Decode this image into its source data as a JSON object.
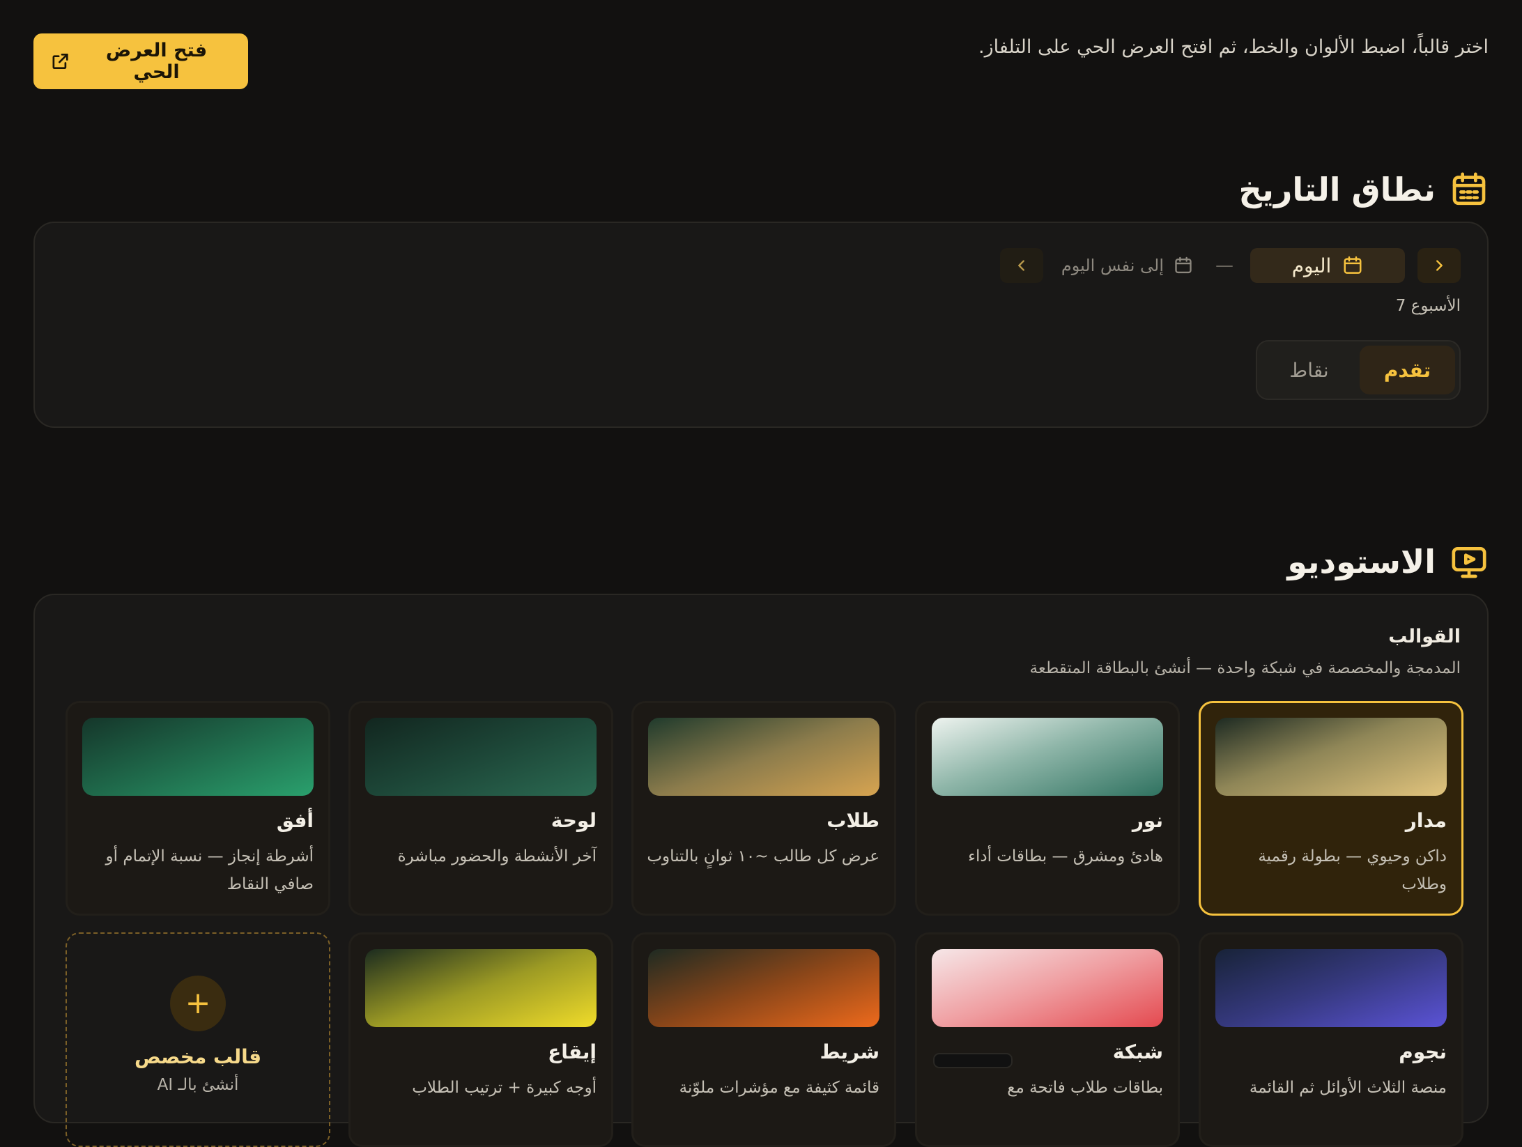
{
  "header": {
    "intro_text": "اختر قالباً، اضبط الألوان والخط، ثم افتح العرض الحي على التلفاز.",
    "live_button_label": "فتح العرض الحي"
  },
  "date_range": {
    "title": "نطاق التاريخ",
    "from_label": "اليوم",
    "to_label": "إلى نفس اليوم",
    "separator": "—",
    "week_label": "الأسبوع 7",
    "modes": [
      {
        "label": "تقدم",
        "active": true
      },
      {
        "label": "نقاط",
        "active": false
      }
    ]
  },
  "studio": {
    "title": "الاستوديو",
    "templates_heading": "القوالب",
    "templates_subtitle": "المدمجة والمخصصة في شبكة واحدة — أنشئ بالبطاقة المتقطعة",
    "templates": [
      {
        "name": "مدار",
        "desc": "داكن وحيوي — بطولة رقمية وطلاب",
        "selected": true,
        "gradient": [
          "#1d2a22",
          "#e2c47d"
        ]
      },
      {
        "name": "نور",
        "desc": "هادئ ومشرق — بطاقات أداء",
        "selected": false,
        "gradient": [
          "#eef3ef",
          "#2f7260"
        ]
      },
      {
        "name": "طلاب",
        "desc": "عرض كل طالب ~١٠ ثوانٍ بالتناوب",
        "selected": false,
        "gradient": [
          "#1f3a2c",
          "#d7a451"
        ]
      },
      {
        "name": "لوحة",
        "desc": "آخر الأنشطة والحضور مباشرة",
        "selected": false,
        "gradient": [
          "#12261f",
          "#2b6a52"
        ]
      },
      {
        "name": "أفق",
        "desc": "أشرطة إنجاز — نسبة الإتمام أو صافي النقاط",
        "selected": false,
        "gradient": [
          "#15362a",
          "#2aa06d"
        ]
      },
      {
        "name": "نجوم",
        "desc": "منصة الثلاث الأوائل ثم القائمة",
        "selected": false,
        "gradient": [
          "#182338",
          "#5b53d6"
        ]
      },
      {
        "name": "شبكة",
        "desc": "بطاقات طلاب فاتحة مع",
        "selected": false,
        "gradient": [
          "#f6e7e8",
          "#e4494f"
        ]
      },
      {
        "name": "شريط",
        "desc": "قائمة كثيفة مع مؤشرات ملوّنة",
        "selected": false,
        "gradient": [
          "#1e2a22",
          "#ee6a1c"
        ]
      },
      {
        "name": "إيقاع",
        "desc": "أوجه كبيرة + ترتيب الطلاب",
        "selected": false,
        "gradient": [
          "#1b2b1f",
          "#f0dc2a"
        ]
      }
    ],
    "custom": {
      "plus": "+",
      "name": "قالب مخصص",
      "desc": "أنشئ بالـ AI"
    }
  },
  "colors": {
    "accent": "#f6c23e",
    "background": "#121110",
    "panel": "#191817",
    "selected_card": "#30230b"
  },
  "icons": {
    "live_button": "external-link-icon",
    "date_title": "calendar-icon",
    "studio_title": "monitor-play-icon",
    "nav_next": "chevron-right-icon",
    "nav_prev": "chevron-left-icon",
    "date_pill": "calendar-icon"
  }
}
